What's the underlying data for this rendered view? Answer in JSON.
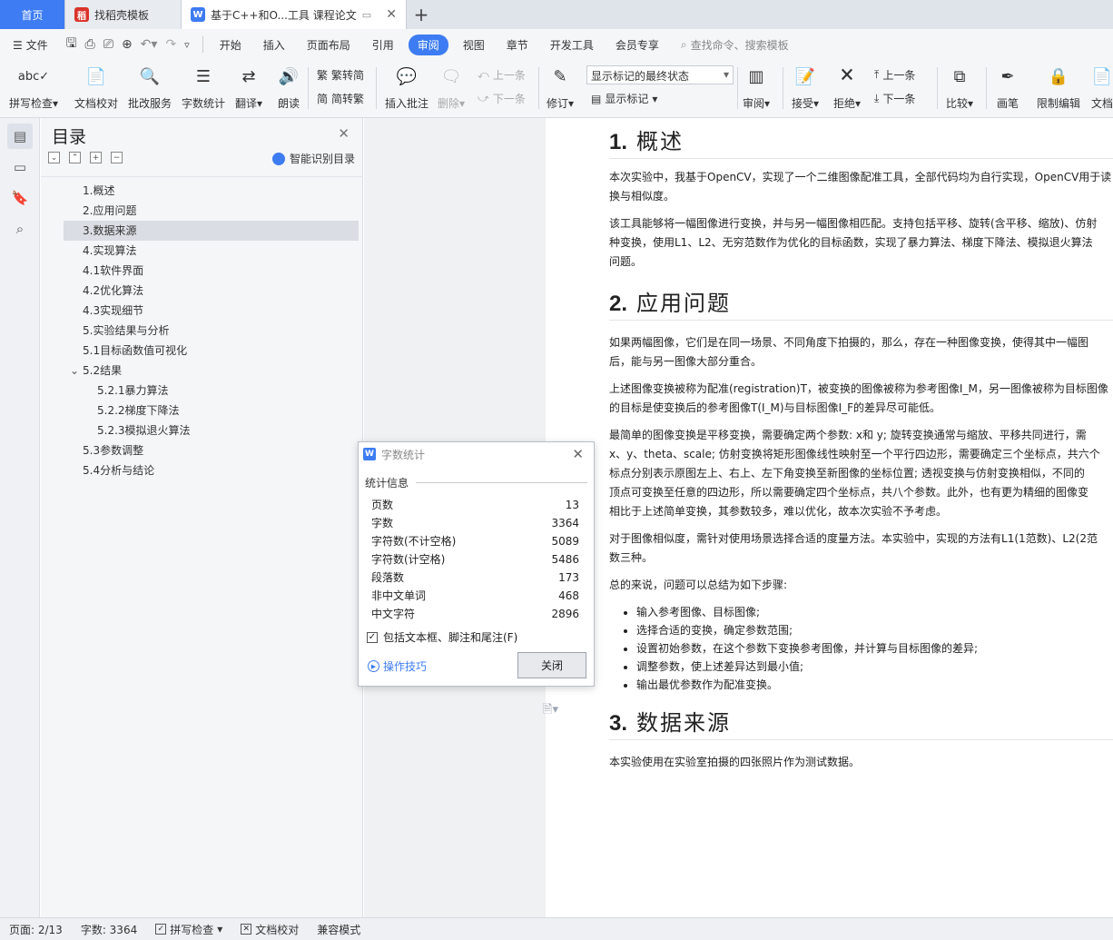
{
  "tabs": {
    "home": "首页",
    "template": "找稻壳模板",
    "doc": "基于C++和O...工具 课程论文"
  },
  "menu": {
    "file": "文件",
    "items": [
      "开始",
      "插入",
      "页面布局",
      "引用",
      "审阅",
      "视图",
      "章节",
      "开发工具",
      "会员专享"
    ],
    "active": "审阅",
    "search": "查找命令、搜索模板"
  },
  "ribbon": {
    "spellcheck": "拼写检查",
    "doc_proof": "文档校对",
    "batch": "批改服务",
    "word_count": "字数统计",
    "translate": "翻译",
    "read_aloud": "朗读",
    "to_trad": "繁转简",
    "to_simp": "简转繁",
    "insert_comment": "插入批注",
    "delete": "删除",
    "prev": "上一条",
    "next": "下一条",
    "revise": "修订",
    "markup_state": "显示标记的最终状态",
    "show_markup": "显示标记",
    "review": "审阅",
    "accept": "接受",
    "reject": "拒绝",
    "prev2": "上一条",
    "next2": "下一条",
    "compare": "比较",
    "pen": "画笔",
    "restrict": "限制编辑",
    "doc_more": "文档"
  },
  "toc": {
    "title": "目录",
    "smart": "智能识别目录",
    "items": [
      "1.概述",
      "2.应用问题",
      "3.数据来源",
      "4.实现算法",
      "4.1软件界面",
      "4.2优化算法",
      "4.3实现细节",
      "5.实验结果与分析",
      "5.1目标函数值可视化",
      "5.2结果",
      "5.2.1暴力算法",
      "5.2.2梯度下降法",
      "5.2.3模拟退火算法",
      "5.3参数调整",
      "5.4分析与结论"
    ]
  },
  "document": {
    "s1_num": "1.",
    "s1_title": "概述",
    "p1a": "本次实验中，我基于OpenCV，实现了一个二维图像配准工具，全部代码均为自行实现，OpenCV用于读",
    "p1b": "换与相似度。",
    "p2a": "该工具能够将一幅图像进行变换，并与另一幅图像相匹配。支持包括平移、旋转(含平移、缩放)、仿射",
    "p2b": "种变换，使用L1、L2、无穷范数作为优化的目标函数，实现了暴力算法、梯度下降法、模拟退火算法",
    "p2c": "问题。",
    "s2_num": "2.",
    "s2_title": "应用问题",
    "p3a": "如果两幅图像，它们是在同一场景、不同角度下拍摄的，那么，存在一种图像变换，使得其中一幅图",
    "p3b": "后，能与另一图像大部分重合。",
    "p4a": "上述图像变换被称为配准(registration)T，被变换的图像被称为参考图像I_M，另一图像被称为目标图像",
    "p4b": "的目标是使变换后的参考图像T(I_M)与目标图像I_F的差异尽可能低。",
    "p5a": "最简单的图像变换是平移变换，需要确定两个参数: x和 y; 旋转变换通常与缩放、平移共同进行，需",
    "p5b": "x、y、theta、scale;  仿射变换将矩形图像线性映射至一个平行四边形，需要确定三个坐标点，共六个",
    "p5c": "标点分别表示原图左上、右上、左下角变换至新图像的坐标位置;  透视变换与仿射变换相似，不同的",
    "p5d": "顶点可变换至任意的四边形，所以需要确定四个坐标点，共八个参数。此外，也有更为精细的图像变",
    "p5e": "相比于上述简单变换，其参数较多，难以优化，故本次实验不予考虑。",
    "p6a": "对于图像相似度，需针对使用场景选择合适的度量方法。本实验中，实现的方法有L1(1范数)、L2(2范",
    "p6b": "数三种。",
    "p7": "总的来说，问题可以总结为如下步骤:",
    "bullets": [
      "输入参考图像、目标图像;",
      "选择合适的变换，确定参数范围;",
      "设置初始参数，在这个参数下变换参考图像，并计算与目标图像的差异;",
      "调整参数，使上述差异达到最小值;",
      "输出最优参数作为配准变换。"
    ],
    "s3_num": "3.",
    "s3_title": "数据来源",
    "p8": "本实验使用在实验室拍摄的四张照片作为测试数据。"
  },
  "dialog": {
    "title": "字数统计",
    "section": "统计信息",
    "rows": [
      {
        "label": "页数",
        "value": "13"
      },
      {
        "label": "字数",
        "value": "3364"
      },
      {
        "label": "字符数(不计空格)",
        "value": "5089"
      },
      {
        "label": "字符数(计空格)",
        "value": "5486"
      },
      {
        "label": "段落数",
        "value": "173"
      },
      {
        "label": "非中文单词",
        "value": "468"
      },
      {
        "label": "中文字符",
        "value": "2896"
      }
    ],
    "checkbox": "包括文本框、脚注和尾注(F)",
    "tips": "操作技巧",
    "close": "关闭"
  },
  "status": {
    "page": "页面: 2/13",
    "words": "字数: 3364",
    "spell": "拼写检查",
    "proof": "文档校对",
    "compat": "兼容模式"
  },
  "colors": {
    "accent": "#3d7cf2",
    "template_icon": "#d9342b"
  }
}
